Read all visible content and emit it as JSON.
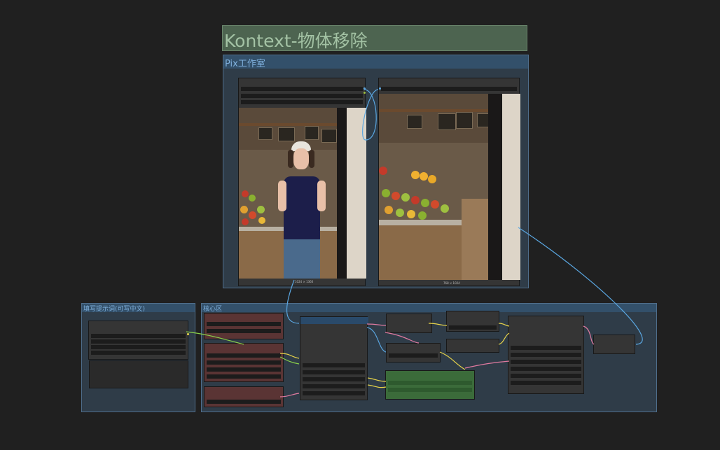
{
  "title_note": "Kontext-物体移除",
  "groups": {
    "pix": "Pix工作室",
    "prompt": "填写提示词(可写中文)",
    "core": "核心区"
  },
  "images": {
    "left_resolution": "1024 × 1360",
    "right_resolution": "768 × 1024"
  },
  "colors": {
    "canvas": "#202020",
    "group_bg": "#2f3c48",
    "group_header": "#33506a",
    "title_bg": "#4d6450",
    "link_blue": "#5aa6e0",
    "link_yellow": "#e8d44a",
    "link_pink": "#e07aa0",
    "link_green": "#8ad04a",
    "node_red": "#5a3434",
    "node_green": "#3b6b3a"
  }
}
